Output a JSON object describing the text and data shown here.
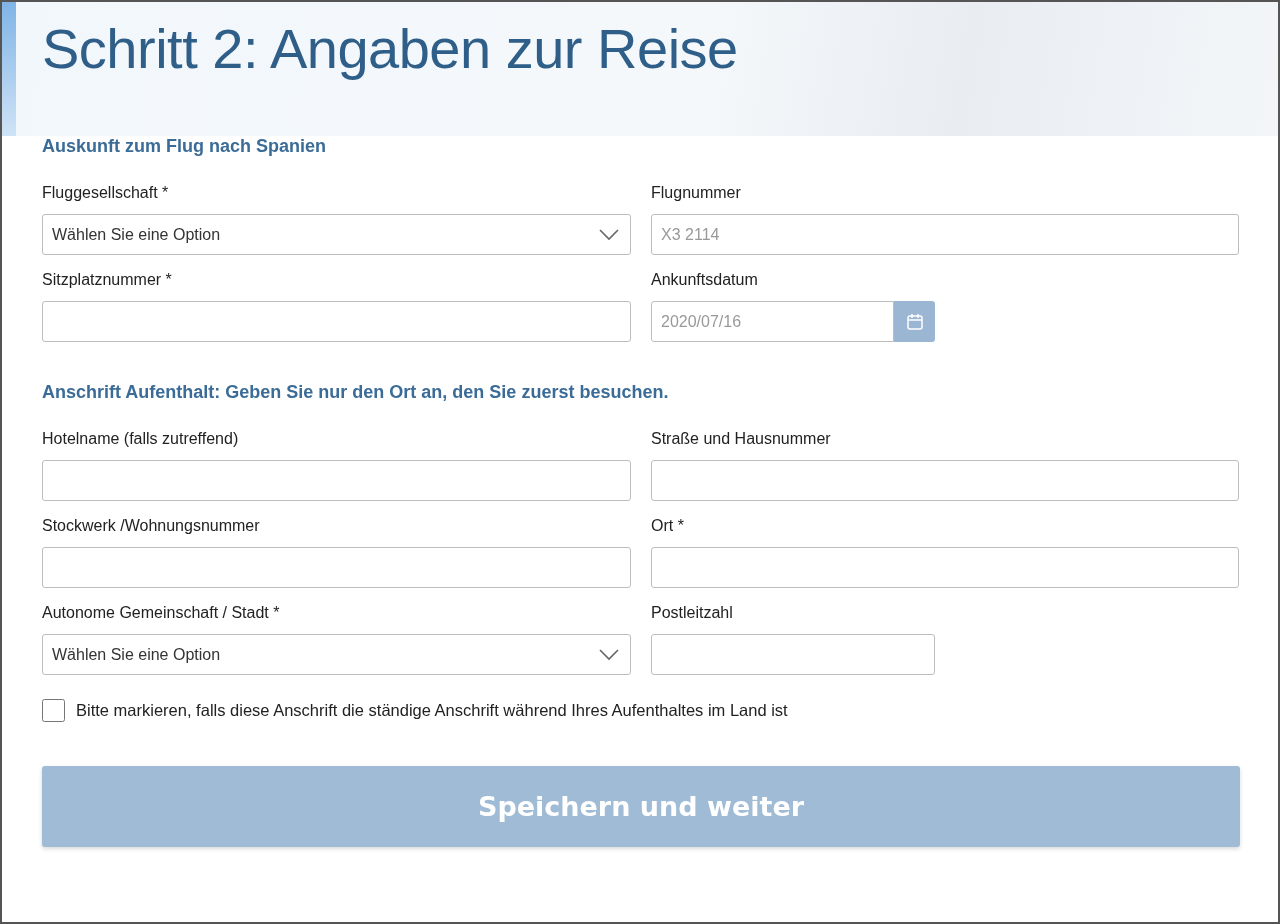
{
  "title": "Schritt 2: Angaben zur Reise",
  "sections": [
    {
      "heading": "Auskunft zum Flug nach Spanien",
      "fields": [
        {
          "kind": "select",
          "label": "Fluggesellschaft *",
          "placeholder": "Wählen Sie eine Option",
          "short": false
        },
        {
          "kind": "text",
          "label": "Flugnummer",
          "placeholder": "X3 2114",
          "short": false
        },
        {
          "kind": "text",
          "label": "Sitzplatznummer *",
          "short": false
        },
        {
          "kind": "date",
          "label": "Ankunftsdatum",
          "placeholder": "2020/07/16",
          "short": true
        }
      ]
    },
    {
      "heading": "Anschrift Aufenthalt: Geben Sie nur den Ort an, den Sie zuerst besuchen.",
      "fields": [
        {
          "kind": "text",
          "label": "Hotelname (falls zutreffend)",
          "short": false
        },
        {
          "kind": "text",
          "label": "Straße und Hausnummer",
          "short": false
        },
        {
          "kind": "text",
          "label": "Stockwerk /Wohnungsnummer",
          "short": false
        },
        {
          "kind": "text",
          "label": "Ort *",
          "short": false
        },
        {
          "kind": "select",
          "label": "Autonome Gemeinschaft / Stadt *",
          "placeholder": "Wählen Sie eine Option",
          "short": false
        },
        {
          "kind": "text",
          "label": "Postleitzahl",
          "short": true
        }
      ]
    }
  ],
  "checkbox": {
    "label": "Bitte markieren, falls diese Anschrift die ständige Anschrift während Ihres Aufenthaltes im Land ist",
    "checked": false
  },
  "submit": {
    "label": "Speichern und weiter",
    "disabled": true
  }
}
